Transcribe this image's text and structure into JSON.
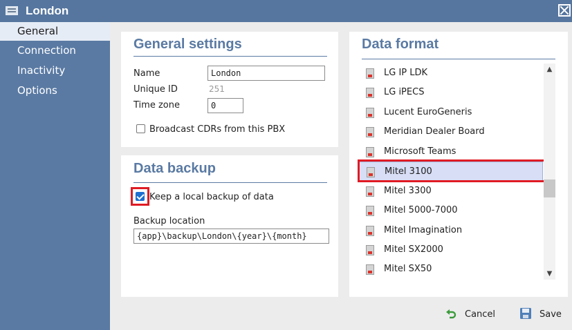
{
  "window": {
    "title": "London",
    "close_icon": "close-icon"
  },
  "sidebar": {
    "items": [
      {
        "label": "General",
        "active": true
      },
      {
        "label": "Connection",
        "active": false
      },
      {
        "label": "Inactivity",
        "active": false
      },
      {
        "label": "Options",
        "active": false
      }
    ]
  },
  "general_settings": {
    "title": "General settings",
    "name_label": "Name",
    "name_value": "London",
    "unique_id_label": "Unique ID",
    "unique_id_value": "251",
    "time_zone_label": "Time zone",
    "time_zone_value": "0",
    "broadcast_label": "Broadcast CDRs from this PBX",
    "broadcast_checked": false
  },
  "data_backup": {
    "title": "Data backup",
    "keep_backup_label": "Keep a local backup of data",
    "keep_backup_checked": true,
    "location_label": "Backup location",
    "location_value": "{app}\\backup\\London\\{year}\\{month}"
  },
  "data_format": {
    "title": "Data format",
    "items": [
      "LG IP LDK",
      "LG iPECS",
      "Lucent EuroGeneris",
      "Meridian Dealer Board",
      "Microsoft Teams",
      "Mitel 3100",
      "Mitel 3300",
      "Mitel 5000-7000",
      "Mitel Imagination",
      "Mitel SX2000",
      "Mitel SX50"
    ],
    "selected": "Mitel 3100"
  },
  "footer": {
    "cancel_label": "Cancel",
    "save_label": "Save"
  },
  "colors": {
    "accent": "#5a7aa3",
    "highlight": "#e01b24",
    "selection": "#d7def5",
    "check": "#1e6fd0"
  }
}
